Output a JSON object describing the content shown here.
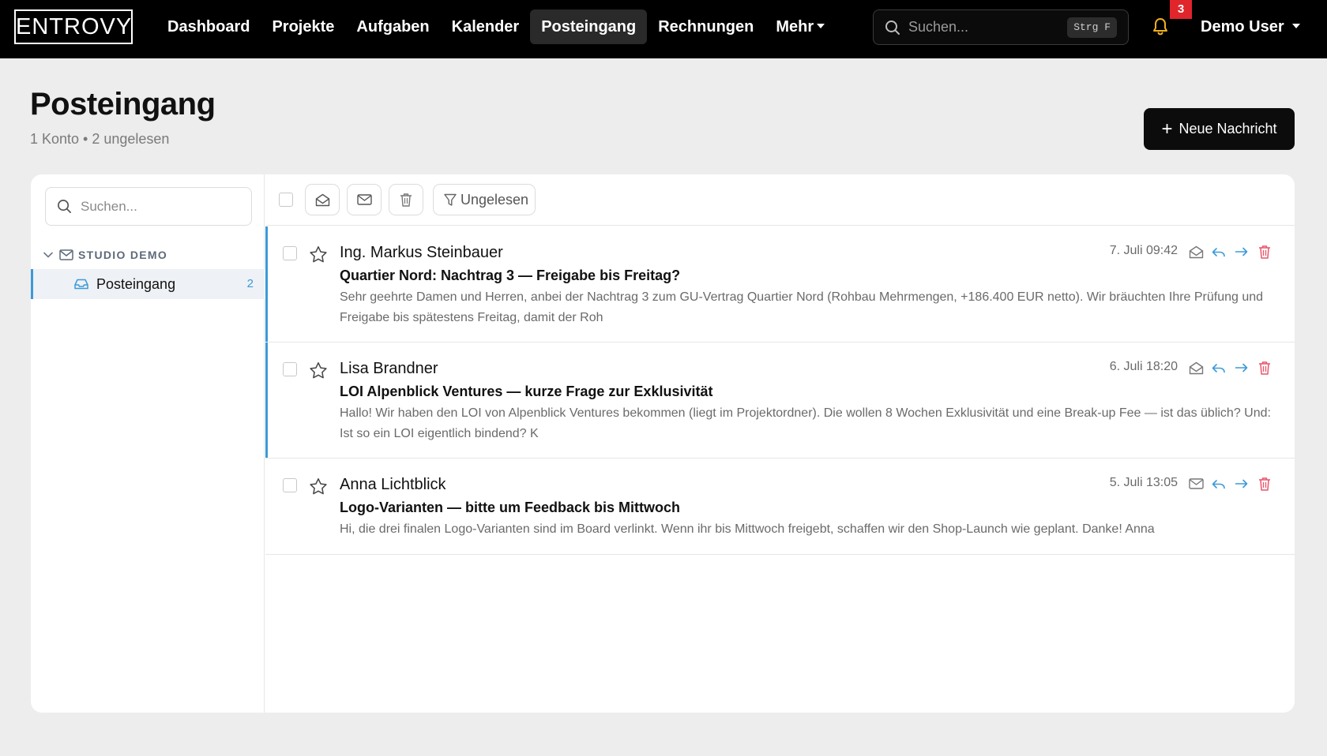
{
  "app": {
    "logo": "ENTROVY"
  },
  "nav": {
    "items": [
      "Dashboard",
      "Projekte",
      "Aufgaben",
      "Kalender",
      "Posteingang",
      "Rechnungen"
    ],
    "more": "Mehr"
  },
  "global_search": {
    "placeholder": "Suchen...",
    "shortcut": "Strg F"
  },
  "notifications": {
    "count": "3"
  },
  "user": {
    "name": "Demo User"
  },
  "header": {
    "title": "Posteingang",
    "subtitle": "1 Konto • 2 ungelesen",
    "new_button": "Neue Nachricht"
  },
  "sidebar": {
    "search_placeholder": "Suchen...",
    "account": "STUDIO DEMO",
    "folder": {
      "name": "Posteingang",
      "count": "2"
    }
  },
  "toolbar": {
    "filter_label": "Ungelesen"
  },
  "messages": [
    {
      "from": "Ing. Markus Steinbauer",
      "subject": "Quartier Nord: Nachtrag 3 — Freigabe bis Freitag?",
      "preview": "Sehr geehrte Damen und Herren, anbei der Nachtrag 3 zum GU-Vertrag Quartier Nord (Rohbau Mehrmengen, +186.400 EUR netto). Wir bräuchten Ihre Prüfung und Freigabe bis spätestens Freitag, damit der Roh",
      "date": "7. Juli 09:42",
      "unread": true
    },
    {
      "from": "Lisa Brandner",
      "subject": "LOI Alpenblick Ventures — kurze Frage zur Exklusivität",
      "preview": "Hallo! Wir haben den LOI von Alpenblick Ventures bekommen (liegt im Projektordner). Die wollen 8 Wochen Exklusivität und eine Break-up Fee — ist das üblich? Und: Ist so ein LOI eigentlich bindend? K",
      "date": "6. Juli 18:20",
      "unread": true
    },
    {
      "from": "Anna Lichtblick",
      "subject": "Logo-Varianten — bitte um Feedback bis Mittwoch",
      "preview": "Hi, die drei finalen Logo-Varianten sind im Board verlinkt. Wenn ihr bis Mittwoch freigebt, schaffen wir den Shop-Launch wie geplant. Danke! Anna",
      "date": "5. Juli 13:05",
      "unread": false
    }
  ],
  "colors": {
    "accent": "#3b9ad9",
    "bell": "#f2b01e",
    "badge": "#e0252b",
    "delete": "#e8556a"
  }
}
